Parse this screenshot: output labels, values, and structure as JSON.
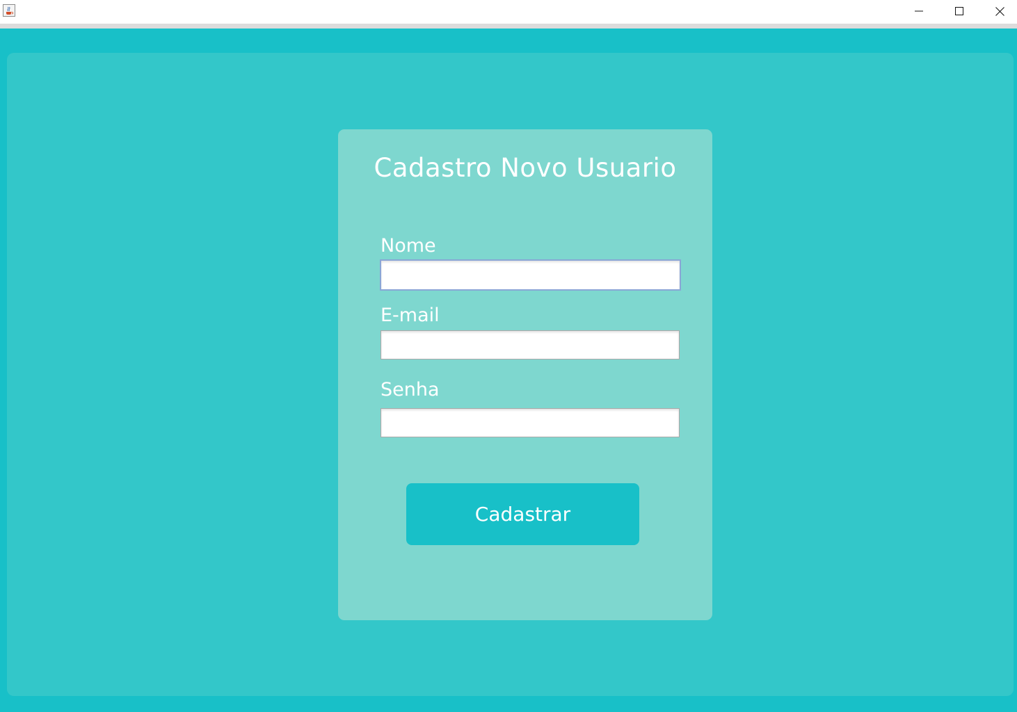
{
  "window": {
    "icon": "java-coffee-icon",
    "controls": {
      "minimize": "minimize-icon",
      "maximize": "maximize-icon",
      "close": "close-icon"
    }
  },
  "form": {
    "title": "Cadastro Novo Usuario",
    "fields": [
      {
        "label": "Nome",
        "value": "",
        "placeholder": ""
      },
      {
        "label": "E-mail",
        "value": "",
        "placeholder": ""
      },
      {
        "label": "Senha",
        "value": "",
        "placeholder": ""
      }
    ],
    "submit_label": "Cadastrar"
  },
  "colors": {
    "background": "#18c0c8",
    "panel": "#33c7c9",
    "card": "#7ed7cf",
    "button": "#18c0c8",
    "text": "#ffffff"
  }
}
